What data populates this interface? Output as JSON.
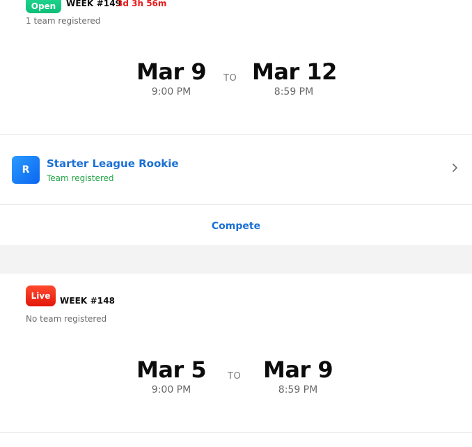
{
  "tournaments": [
    {
      "status_badge": "Open",
      "week": "WEEK #149",
      "countdown": "3d 3h 56m",
      "registration_note": "1 team registered",
      "start": {
        "date": "Mar 9",
        "time": "9:00 PM"
      },
      "separator": "TO",
      "end": {
        "date": "Mar 12",
        "time": "8:59 PM"
      },
      "team": {
        "avatar_initial": "R",
        "name": "Starter League Rookie",
        "status": "Team registered"
      },
      "action_label": "Compete"
    },
    {
      "status_badge": "Live",
      "week": "WEEK #148",
      "registration_note": "No team registered",
      "start": {
        "date": "Mar 5",
        "time": "9:00 PM"
      },
      "separator": "TO",
      "end": {
        "date": "Mar 9",
        "time": "8:59 PM"
      }
    }
  ],
  "colors": {
    "open_badge": "#1ccf87",
    "live_badge": "#f0301c",
    "countdown": "#ea1c1c",
    "link_blue": "#1a6fd4",
    "registered_green": "#22a546",
    "section_gap": "#f3f3f4"
  },
  "icons": {
    "team_row_chevron": "chevron-right-icon"
  }
}
